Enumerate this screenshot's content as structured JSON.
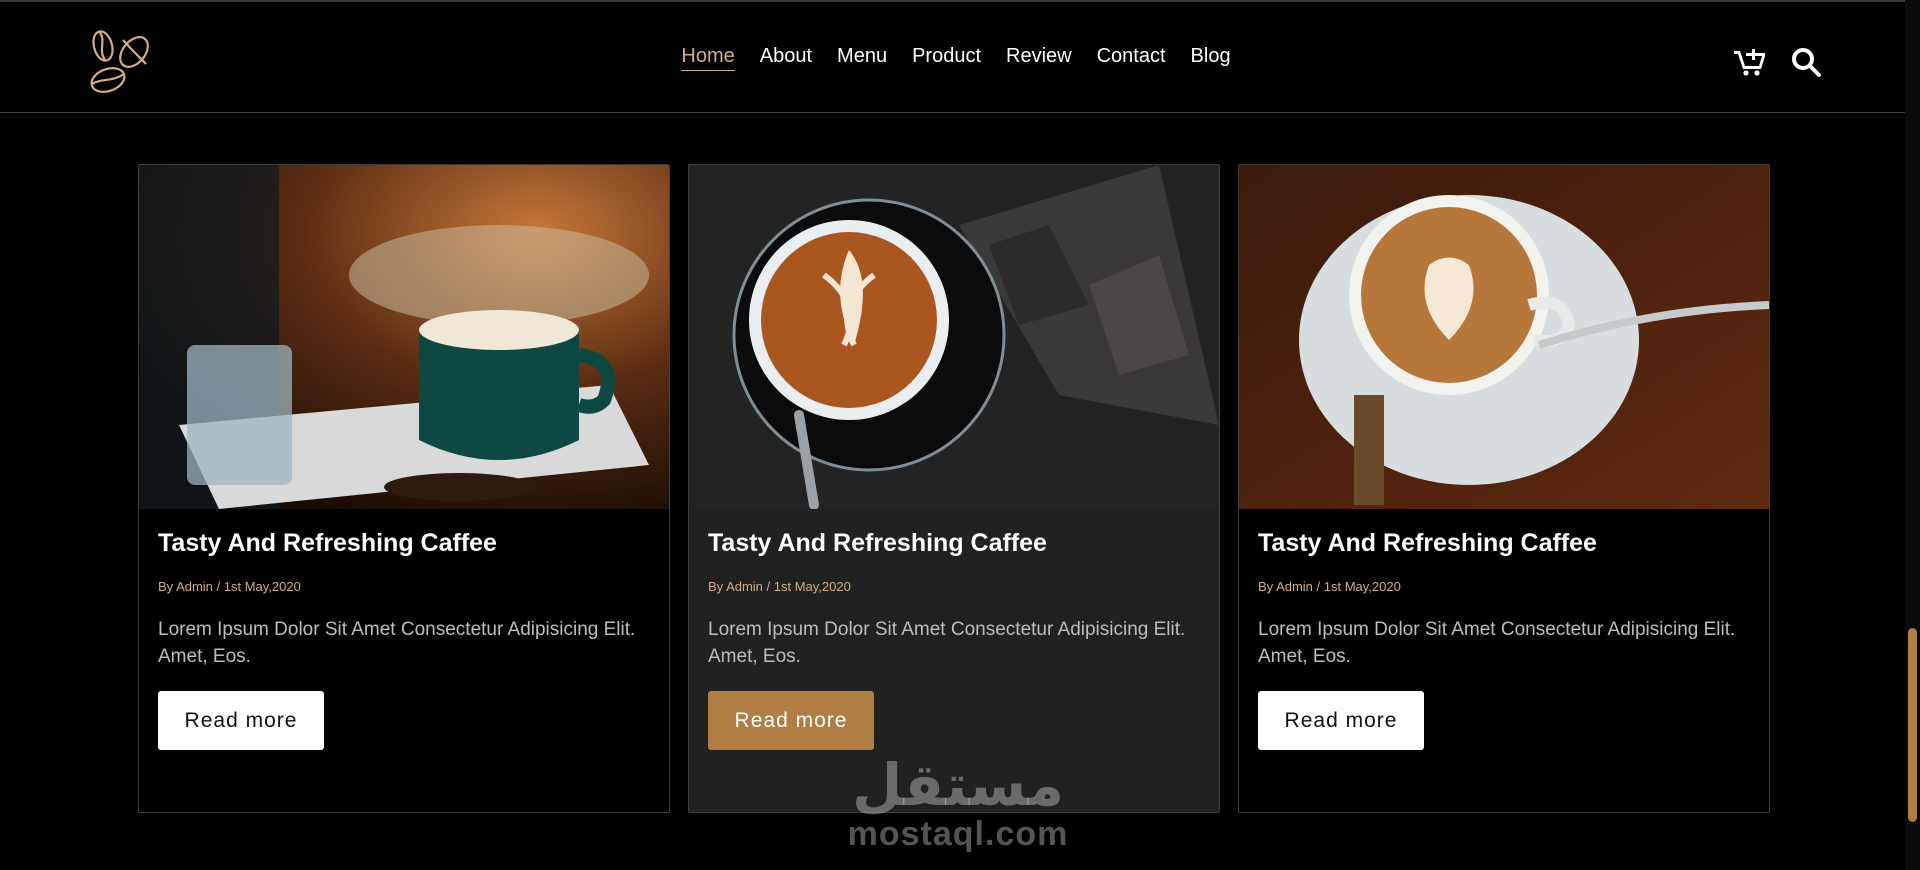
{
  "nav": {
    "logo_icon": "coffee-beans-icon",
    "items": [
      {
        "label": "Home",
        "active": true
      },
      {
        "label": "About"
      },
      {
        "label": "Menu"
      },
      {
        "label": "Product"
      },
      {
        "label": "Review"
      },
      {
        "label": "Contact"
      },
      {
        "label": "Blog"
      }
    ],
    "cart_icon": "shopping-cart-icon",
    "search_icon": "search-icon"
  },
  "blog": {
    "cards": [
      {
        "image": "coffee-and-glass-on-tray",
        "title": "Tasty And Refreshing Caffee",
        "meta": "By Admin / 1st May,2020",
        "description": "Lorem Ipsum Dolor Sit Amet Consectetur Adipisicing Elit. Amet, Eos.",
        "button": "Read more"
      },
      {
        "image": "latte-art-black-cup",
        "title": "Tasty And Refreshing Caffee",
        "meta": "By Admin / 1st May,2020",
        "description": "Lorem Ipsum Dolor Sit Amet Consectetur Adipisicing Elit. Amet, Eos.",
        "button": "Read more"
      },
      {
        "image": "latte-art-white-cup",
        "title": "Tasty And Refreshing Caffee",
        "meta": "By Admin / 1st May,2020",
        "description": "Lorem Ipsum Dolor Sit Amet Consectetur Adipisicing Elit. Amet, Eos.",
        "button": "Read more"
      }
    ]
  },
  "watermark": {
    "arabic": "مستقل",
    "latin": "mostaql.com"
  },
  "colors": {
    "accent": "#d3ad7f",
    "button_active": "#b07d43",
    "background": "#000000",
    "card_highlight": "#212121"
  }
}
